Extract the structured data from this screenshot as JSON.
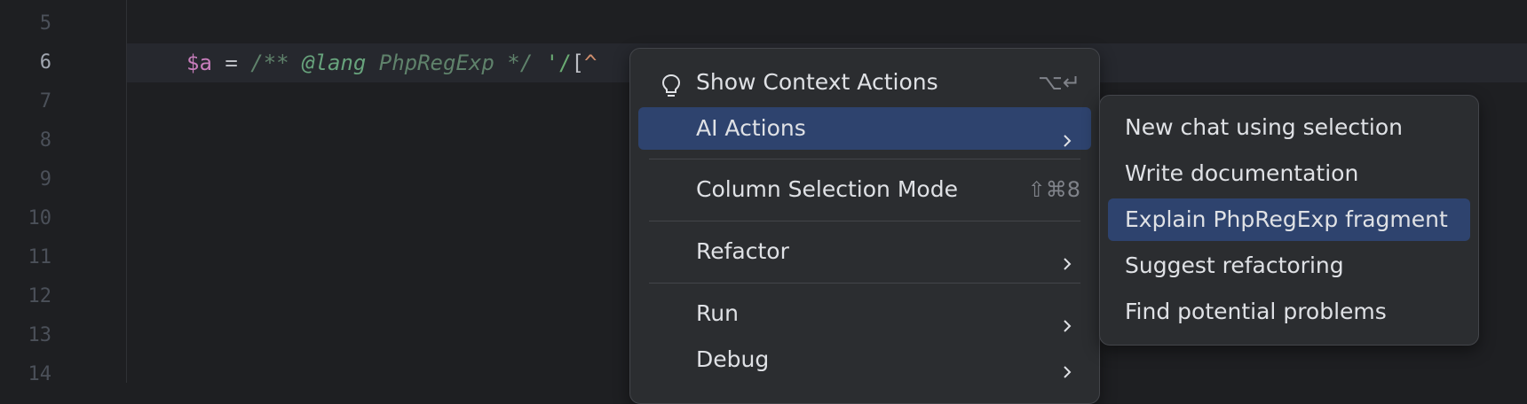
{
  "editor": {
    "line_numbers": [
      "5",
      "6",
      "7",
      "8",
      "9",
      "10",
      "11",
      "12",
      "13",
      "14"
    ],
    "current_line": "6",
    "code": {
      "var": "$a",
      "assign": " = ",
      "comment_open": "/** ",
      "lang_tag": "@lang",
      "lang_name": " PhpRegExp ",
      "comment_close": "*/",
      "space": " ",
      "string_quote": "'/",
      "bracket": "[",
      "caret": "^"
    }
  },
  "context_menu": {
    "items": [
      {
        "label": "Show Context Actions",
        "shortcut": "⌥↵",
        "icon": "lightbulb-icon"
      },
      {
        "label": "AI Actions",
        "submenu": true,
        "selected": true
      },
      {
        "label": "Column Selection Mode",
        "shortcut": "⇧⌘8"
      },
      {
        "label": "Refactor",
        "submenu": true
      },
      {
        "label": "Run",
        "submenu": true
      },
      {
        "label": "Debug",
        "submenu": true
      }
    ]
  },
  "ai_submenu": {
    "items": [
      {
        "label": "New chat using selection"
      },
      {
        "label": "Write documentation"
      },
      {
        "label": "Explain PhpRegExp fragment",
        "selected": true
      },
      {
        "label": "Suggest refactoring"
      },
      {
        "label": "Find potential problems"
      }
    ]
  },
  "colors": {
    "background": "#1e1f22",
    "menu_background": "#2b2d30",
    "selection": "#2e436e",
    "text": "#dfe1e5",
    "shortcut_text": "#80838a"
  }
}
